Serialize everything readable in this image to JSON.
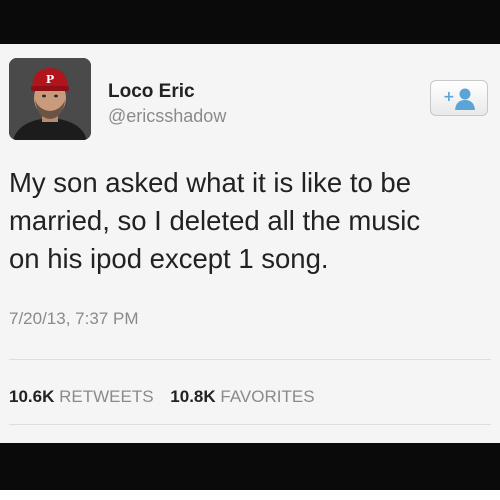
{
  "tweet": {
    "user": {
      "name": "Loco Eric",
      "handle": "@ericsshadow"
    },
    "lines": [
      "My son asked what it is like to be",
      "married, so I deleted all the music",
      "on his ipod except 1 song."
    ],
    "timestamp": "7/20/13, 7:37 PM",
    "stats": {
      "retweets_count": "10.6K",
      "retweets_label": "RETWEETS",
      "favorites_count": "10.8K",
      "favorites_label": "FAVORITES"
    },
    "follow_icon": "add-user-icon",
    "cap_logo": "P"
  },
  "colors": {
    "bar": "#0a0a0a",
    "card_bg": "#f5f5f5",
    "follow_icon": "#5aa5d6",
    "cap": "#b0141c"
  }
}
